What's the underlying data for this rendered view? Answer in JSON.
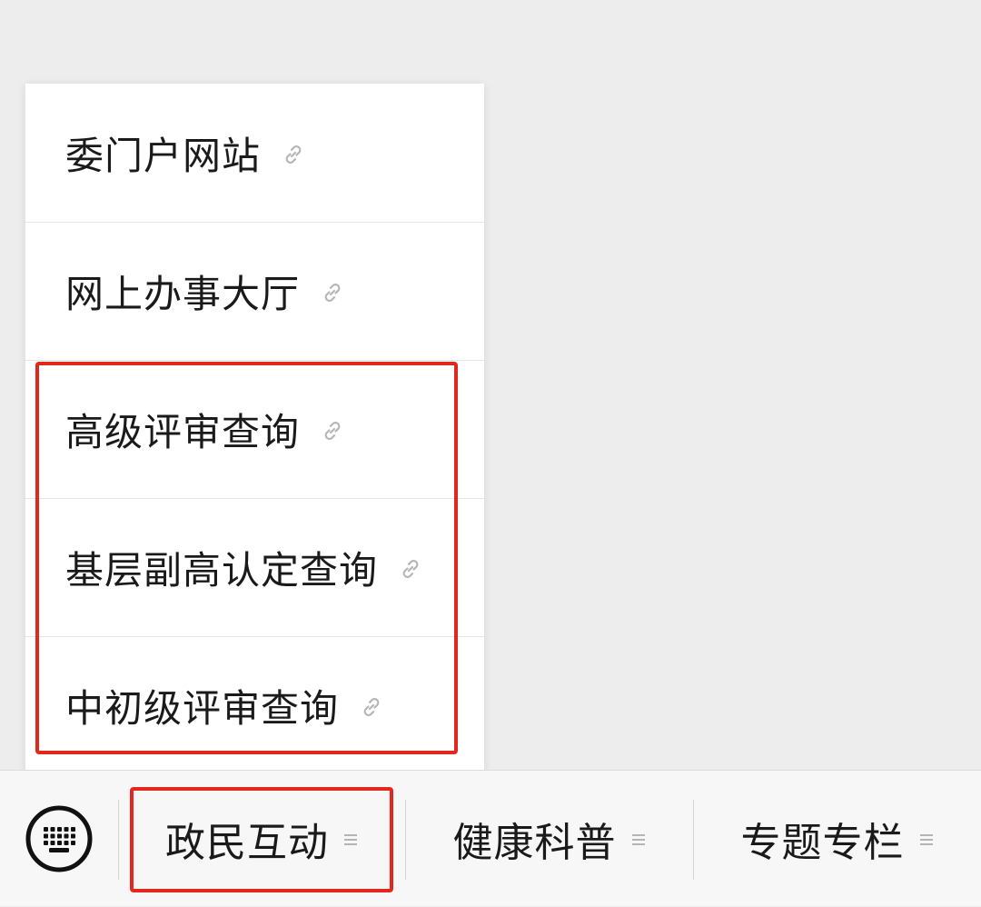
{
  "menu": {
    "items": [
      {
        "label": "委门户网站",
        "icon": "link-icon"
      },
      {
        "label": "网上办事大厅",
        "icon": "link-icon"
      },
      {
        "label": "高级评审查询",
        "icon": "link-icon"
      },
      {
        "label": "基层副高认定查询",
        "icon": "link-icon"
      },
      {
        "label": "中初级评审查询",
        "icon": "link-icon"
      }
    ]
  },
  "bottom_bar": {
    "keyboard_icon": "keyboard-icon",
    "tabs": [
      {
        "label": "政民互动",
        "icon": "menu-lines-icon",
        "active": true
      },
      {
        "label": "健康科普",
        "icon": "menu-lines-icon",
        "active": false
      },
      {
        "label": "专题专栏",
        "icon": "menu-lines-icon",
        "active": false
      }
    ]
  },
  "colors": {
    "highlight": "#e3271d",
    "background": "#ededed",
    "panel": "#ffffff",
    "text": "#1a1a1a",
    "icon_gray": "#b5b5b5"
  }
}
